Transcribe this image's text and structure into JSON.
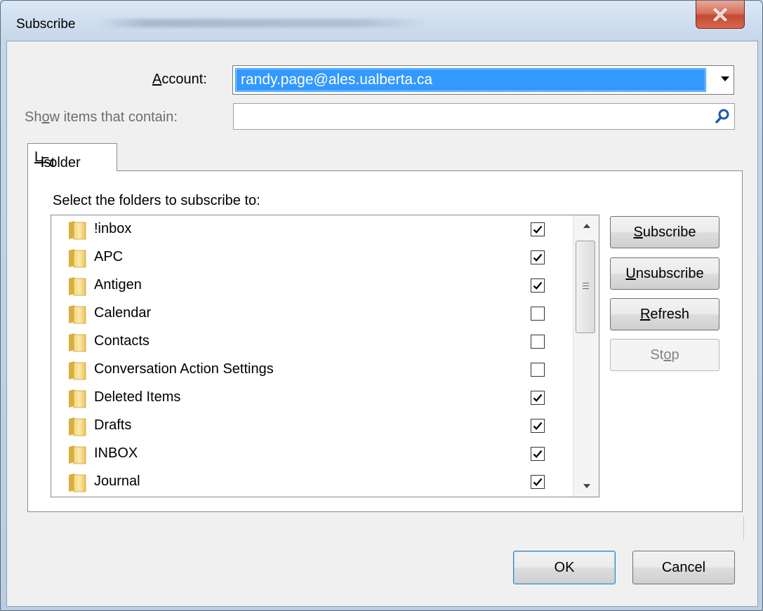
{
  "window": {
    "title": "Subscribe",
    "close_icon": "close-icon"
  },
  "account": {
    "label_pre": "",
    "label_mnemonic": "A",
    "label_post": "ccount:",
    "value": "randy.page@ales.ualberta.ca"
  },
  "filter": {
    "label_pre": "Sh",
    "label_mnemonic": "o",
    "label_post": "w items that contain:",
    "value": "",
    "icon": "search-icon"
  },
  "tab": {
    "label_pre": "Folder ",
    "label_mnemonic": "L",
    "label_post": "ist"
  },
  "list": {
    "heading": "Select the folders to subscribe to:",
    "items": [
      {
        "name": "!inbox",
        "checked": true
      },
      {
        "name": "APC",
        "checked": true
      },
      {
        "name": "Antigen",
        "checked": true
      },
      {
        "name": "Calendar",
        "checked": false
      },
      {
        "name": "Contacts",
        "checked": false
      },
      {
        "name": "Conversation Action Settings",
        "checked": false
      },
      {
        "name": "Deleted Items",
        "checked": true
      },
      {
        "name": "Drafts",
        "checked": true
      },
      {
        "name": "INBOX",
        "checked": true
      },
      {
        "name": "Journal",
        "checked": true
      }
    ]
  },
  "side_buttons": {
    "subscribe": {
      "mnemonic": "S",
      "rest": "ubscribe"
    },
    "unsubscribe": {
      "mnemonic": "U",
      "rest": "nsubscribe"
    },
    "refresh": {
      "mnemonic": "R",
      "rest": "efresh"
    },
    "stop": {
      "pre": "St",
      "mnemonic": "o",
      "rest": "p"
    }
  },
  "footer": {
    "ok": "OK",
    "cancel": "Cancel"
  },
  "colors": {
    "selection": "#3399ff",
    "close_button": "#c44a33",
    "dialog_bg": "#f0f0f0"
  }
}
